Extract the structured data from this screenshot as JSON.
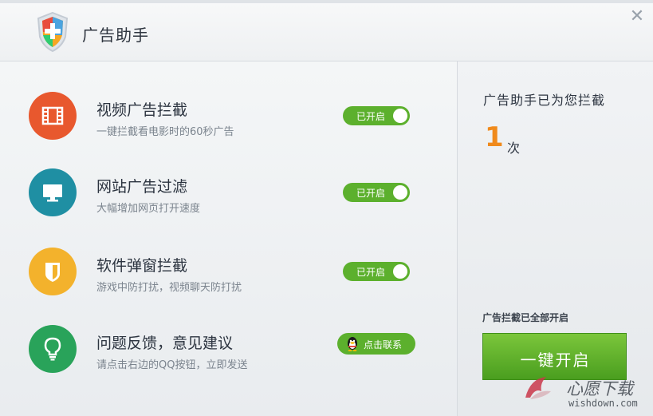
{
  "app": {
    "title": "广告助手",
    "icons": {
      "logo": "shield-plus-icon",
      "close": "close-icon"
    }
  },
  "features": [
    {
      "title": "视频广告拦截",
      "desc": "一键拦截看电影时的60秒广告",
      "icon": "film-icon",
      "color": "#e8582e",
      "toggle": "已开启",
      "enabled": true
    },
    {
      "title": "网站广告过滤",
      "desc": "大幅增加网页打开速度",
      "icon": "monitor-icon",
      "color": "#1f8fa3",
      "toggle": "已开启",
      "enabled": true
    },
    {
      "title": "软件弹窗拦截",
      "desc": "游戏中防打扰，视频聊天防打扰",
      "icon": "shield-icon",
      "color": "#f3b22c",
      "toggle": "已开启",
      "enabled": true
    },
    {
      "title": "问题反馈，意见建议",
      "desc": "请点击右边的QQ按钮，立即发送",
      "icon": "lightbulb-icon",
      "color": "#29a35a",
      "button": "点击联系"
    }
  ],
  "stats": {
    "title": "广告助手已为您拦截",
    "count": "1",
    "unit": "次",
    "status": "广告拦截已全部开启",
    "action_label": "一键开启"
  },
  "watermark": {
    "title": "心愿下载",
    "url": "wishdown.com"
  },
  "colors": {
    "accent_green": "#5cb02d",
    "count_orange": "#f08a1c"
  }
}
